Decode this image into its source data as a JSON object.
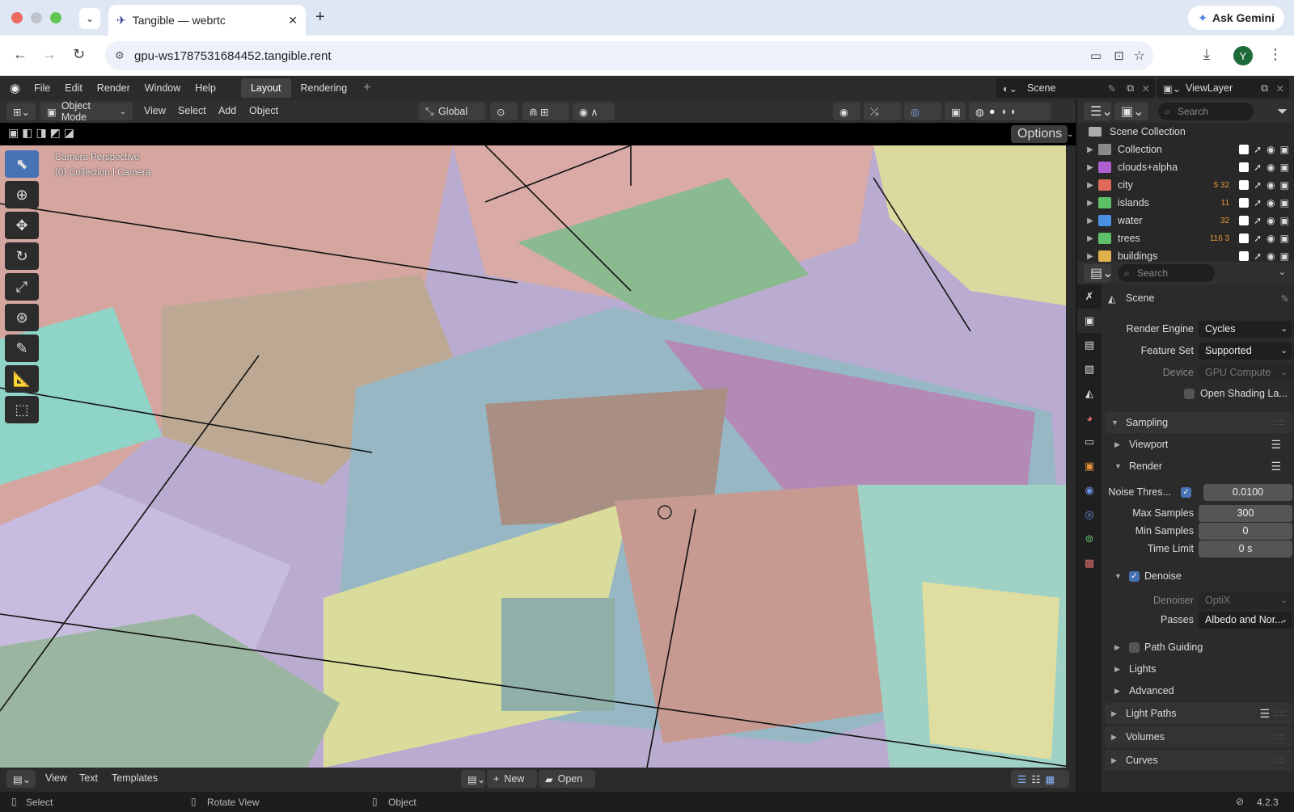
{
  "browser": {
    "tab_title": "Tangible — webrtc",
    "url": "gpu-ws1787531684452.tangible.rent",
    "gemini_label": "Ask Gemini",
    "profile_initial": "Y"
  },
  "blender": {
    "menus": [
      "File",
      "Edit",
      "Render",
      "Window",
      "Help"
    ],
    "workspaces": [
      {
        "label": "Layout",
        "active": true
      },
      {
        "label": "Rendering",
        "active": false
      }
    ],
    "scene": "Scene",
    "view_layer": "ViewLayer",
    "header": {
      "mode": "Object Mode",
      "menus": [
        "View",
        "Select",
        "Add",
        "Object"
      ],
      "orientation": "Global",
      "options": "Options"
    },
    "viewport_info": {
      "line1": "Camera Perspective",
      "line2": "(0) Collection | Camera"
    },
    "tools": [
      "select-box",
      "cursor",
      "move",
      "rotate",
      "scale",
      "transform",
      "annotate",
      "measure",
      "add-cube"
    ],
    "outliner": {
      "search_placeholder": "Search",
      "root": "Scene Collection",
      "collections": [
        {
          "name": "Collection",
          "color": "#8a8a8a",
          "badges": ""
        },
        {
          "name": "clouds+alpha",
          "color": "#b05fd0",
          "badges": ""
        },
        {
          "name": "city",
          "color": "#e06a5a",
          "badges": "5 32"
        },
        {
          "name": "islands",
          "color": "#5fc06a",
          "badges": "11"
        },
        {
          "name": "water",
          "color": "#4b8fe0",
          "badges": "32"
        },
        {
          "name": "trees",
          "color": "#5fc06a",
          "badges": "116 3"
        },
        {
          "name": "buildings",
          "color": "#e0b04b",
          "badges": ""
        }
      ]
    },
    "properties": {
      "search_placeholder": "Search",
      "context": "Scene",
      "render_engine": {
        "label": "Render Engine",
        "value": "Cycles"
      },
      "feature_set": {
        "label": "Feature Set",
        "value": "Supported"
      },
      "device": {
        "label": "Device",
        "value": "GPU Compute"
      },
      "open_shading": "Open Shading La...",
      "sampling": "Sampling",
      "viewport": "Viewport",
      "render": "Render",
      "noise_threshold": {
        "label": "Noise Thres...",
        "value": "0.0100"
      },
      "max_samples": {
        "label": "Max Samples",
        "value": "300"
      },
      "min_samples": {
        "label": "Min Samples",
        "value": "0"
      },
      "time_limit": {
        "label": "Time Limit",
        "value": "0 s"
      },
      "denoise": "Denoise",
      "denoiser": {
        "label": "Denoiser",
        "value": "OptiX"
      },
      "passes": {
        "label": "Passes",
        "value": "Albedo and Nor..."
      },
      "path_guiding": "Path Guiding",
      "lights": "Lights",
      "advanced": "Advanced",
      "light_paths": "Light Paths",
      "volumes": "Volumes",
      "curves": "Curves"
    },
    "text_editor": {
      "menus": [
        "View",
        "Text",
        "Templates"
      ],
      "new_label": "New",
      "open_label": "Open"
    },
    "status": {
      "select": "Select",
      "rotate": "Rotate View",
      "object": "Object",
      "version": "4.2.3"
    }
  }
}
